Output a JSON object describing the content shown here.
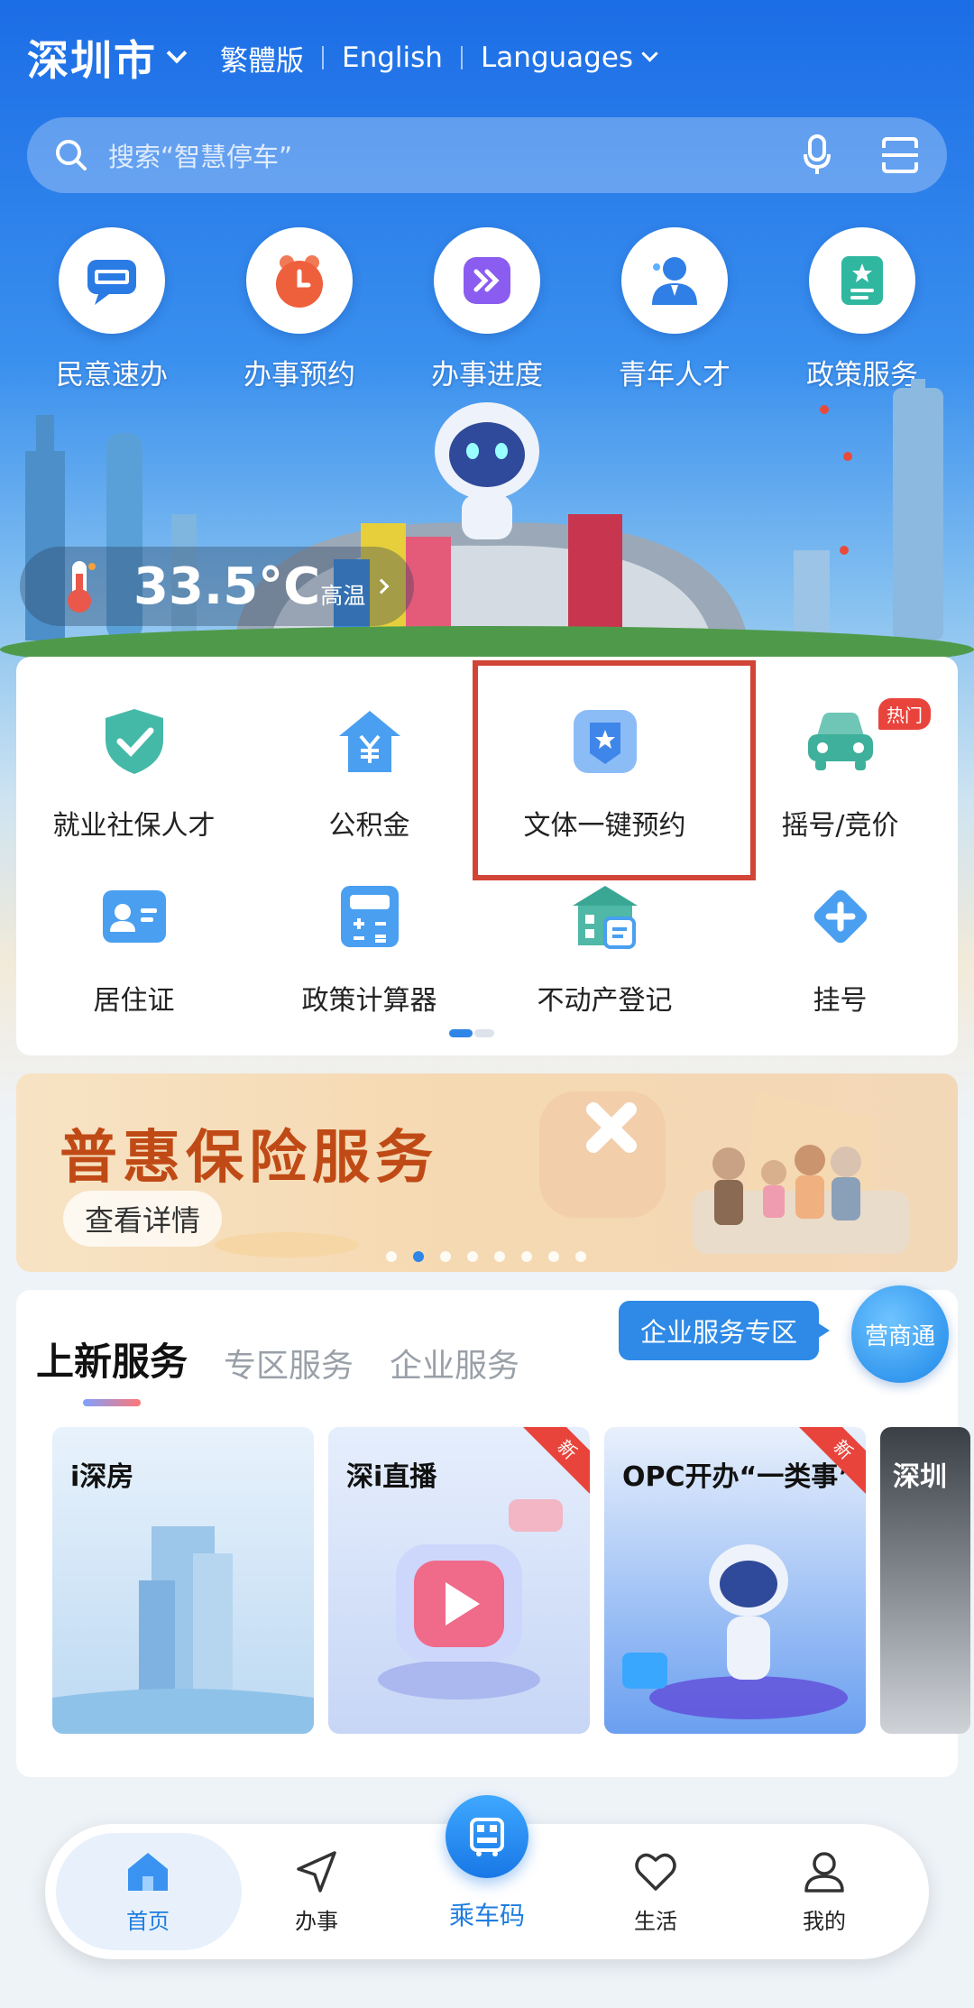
{
  "header": {
    "city": "深圳市",
    "lang_traditional": "繁體版",
    "lang_english": "English",
    "lang_more": "Languages"
  },
  "search": {
    "placeholder": "搜索“智慧停车”"
  },
  "quick_links": [
    {
      "label": "民意速办",
      "icon": "i-shenzhen-chat-icon"
    },
    {
      "label": "办事预约",
      "icon": "clock-icon"
    },
    {
      "label": "办事进度",
      "icon": "progress-arrows-icon"
    },
    {
      "label": "青年人才",
      "icon": "person-icon"
    },
    {
      "label": "政策服务",
      "icon": "policy-document-icon"
    }
  ],
  "weather": {
    "temperature": "33.5°C",
    "level": "高温"
  },
  "services": [
    {
      "label": "就业社保人才",
      "icon": "shield-check-icon"
    },
    {
      "label": "公积金",
      "icon": "house-yuan-icon"
    },
    {
      "label": "文体一键预约",
      "icon": "star-badge-icon"
    },
    {
      "label": "摇号/竞价",
      "icon": "car-icon",
      "badge": "热门"
    },
    {
      "label": "居住证",
      "icon": "id-card-icon"
    },
    {
      "label": "政策计算器",
      "icon": "calculator-icon"
    },
    {
      "label": "不动产登记",
      "icon": "building-certificate-icon"
    },
    {
      "label": "挂号",
      "icon": "medical-plus-icon"
    }
  ],
  "banner": {
    "title": "普惠保险服务",
    "button": "查看详情"
  },
  "new_services": {
    "tabs": [
      "上新服务",
      "专区服务",
      "企业服务"
    ],
    "business_zone": "企业服务专区",
    "yingshangtong": "营商通",
    "cards": [
      {
        "name": "i深房"
      },
      {
        "name": "深i直播",
        "tag": "新"
      },
      {
        "name": "OPC开办“一类事”",
        "tag": "新"
      },
      {
        "name": "深圳"
      }
    ]
  },
  "bottom_nav": {
    "home": "首页",
    "affairs": "办事",
    "ride_code": "乘车码",
    "life": "生活",
    "mine": "我的"
  },
  "colors": {
    "primary_blue": "#1f7de0",
    "highlight_red": "#d24436",
    "banner_orange": "#c04a16"
  }
}
